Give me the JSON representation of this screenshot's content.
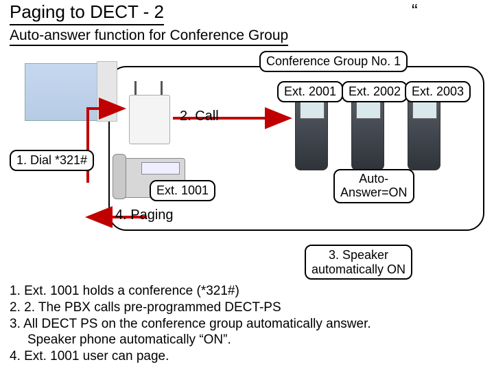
{
  "title": "Paging to DECT - 2",
  "quote_mark": "“",
  "subtitle": "Auto-answer function for Conference Group",
  "group_title": "Conference Group No. 1",
  "call_label": "2. Call",
  "dial_label": "1. Dial *321#",
  "ext1001_label": "Ext. 1001",
  "ext2001_label": "Ext. 2001",
  "ext2002_label": "Ext. 2002",
  "ext2003_label": "Ext. 2003",
  "auto_answer_line1": "Auto-",
  "auto_answer_line2": "Answer=ON",
  "paging_label": "4. Paging",
  "speaker_line1": "3. Speaker",
  "speaker_line2": "automatically ON",
  "steps": {
    "s1": "1. Ext. 1001 holds a conference (*321#)",
    "s2": "2. 2. The PBX calls pre-programmed DECT-PS",
    "s3": "3. All DECT PS on the conference group automatically answer.",
    "s3b": "Speaker phone automatically “ON”.",
    "s4": "4. Ext. 1001 user can page."
  }
}
